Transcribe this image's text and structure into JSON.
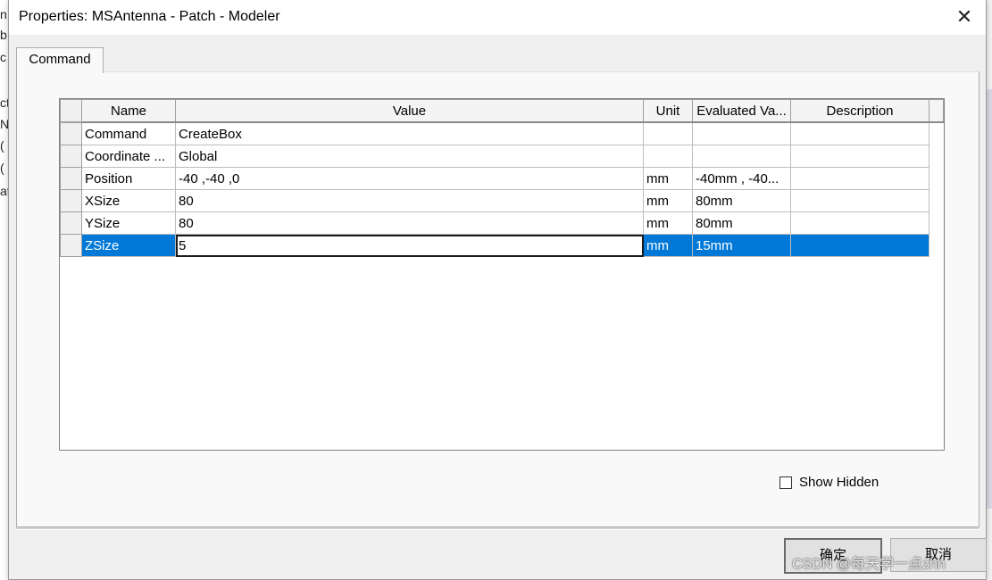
{
  "window": {
    "title": "Properties: MSAntenna - Patch - Modeler",
    "close_symbol": "✕"
  },
  "background_fragments": [
    "n",
    "b",
    "c",
    "ct",
    "N",
    "(",
    "(",
    "at"
  ],
  "tabs": [
    {
      "label": "Command",
      "active": true
    }
  ],
  "grid": {
    "columns": [
      "Name",
      "Value",
      "Unit",
      "Evaluated Va...",
      "Description"
    ],
    "rows": [
      {
        "name": "Command",
        "value": "CreateBox",
        "unit": "",
        "evaluated": "",
        "description": ""
      },
      {
        "name": "Coordinate ...",
        "value": "Global",
        "unit": "",
        "evaluated": "",
        "description": ""
      },
      {
        "name": "Position",
        "value": "-40 ,-40 ,0",
        "unit": "mm",
        "evaluated": "-40mm , -40...",
        "description": ""
      },
      {
        "name": "XSize",
        "value": "80",
        "unit": "mm",
        "evaluated": "80mm",
        "description": ""
      },
      {
        "name": "YSize",
        "value": "80",
        "unit": "mm",
        "evaluated": "80mm",
        "description": ""
      },
      {
        "name": "ZSize",
        "value": "5",
        "unit": "mm",
        "evaluated": "15mm",
        "description": "",
        "selected": true
      }
    ]
  },
  "show_hidden": {
    "label": "Show Hidden",
    "checked": false
  },
  "buttons": {
    "ok": "确定",
    "cancel": "取消"
  },
  "watermark": "CSDN @每天学一点zhn",
  "colors": {
    "selection": "#0078d7",
    "dialog_bg": "#f0f0f0"
  }
}
